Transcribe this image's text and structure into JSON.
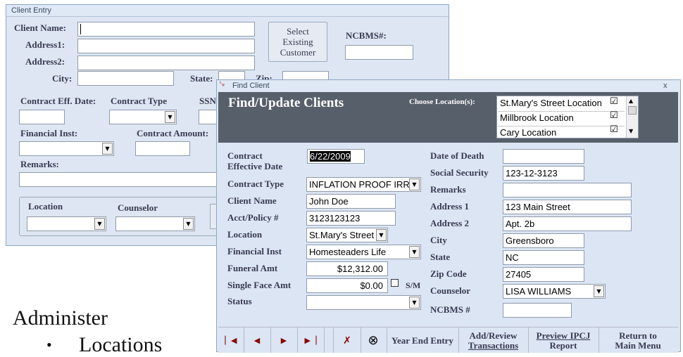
{
  "client_entry": {
    "title": "Client Entry",
    "labels": {
      "client_name": "Client Name:",
      "address1": "Address1:",
      "address2": "Address2:",
      "city": "City:",
      "state": "State:",
      "zip": "Zip:",
      "ncbms": "NCBMS#:",
      "contract_eff_date": "Contract Eff. Date:",
      "contract_type": "Contract Type",
      "ssn": "SSN",
      "financial_inst": "Financial Inst:",
      "contract_amount": "Contract Amount:",
      "remarks": "Remarks:",
      "location": "Location",
      "counselor": "Counselor"
    },
    "select_button": "Select Existing Customer"
  },
  "slide": {
    "heading": "Administer",
    "bullet": "Locations"
  },
  "find_client": {
    "title": "Find Client",
    "close": "x",
    "heading": "Find/Update Clients",
    "choose_location_label": "Choose Location(s):",
    "locations": [
      {
        "name": "St.Mary's Street Location",
        "checked": true
      },
      {
        "name": "Millbrook Location",
        "checked": true
      },
      {
        "name": "Cary Location",
        "checked": true
      }
    ],
    "left": {
      "contract_effective_date_label": "Contract Effective Date",
      "contract_effective_date": "6/22/2009",
      "contract_type_label": "Contract Type",
      "contract_type": "INFLATION PROOF IRRE",
      "client_name_label": "Client Name",
      "client_name": "John Doe",
      "acct_policy_label": "Acct/Policy #",
      "acct_policy": "3123123123",
      "location_label": "Location",
      "location": "St.Mary's Street",
      "financial_inst_label": "Financial Inst",
      "financial_inst": "Homesteaders Life",
      "funeral_amt_label": "Funeral Amt",
      "funeral_amt": "$12,312.00",
      "single_face_amt_label": "Single Face Amt",
      "single_face_amt": "$0.00",
      "sm_label": "S/M",
      "sm_checked": false,
      "status_label": "Status",
      "status": ""
    },
    "right": {
      "date_of_death_label": "Date of Death",
      "date_of_death": "",
      "social_security_label": "Social Security",
      "social_security": "123-12-3123",
      "remarks_label": "Remarks",
      "remarks": "",
      "address1_label": "Address 1",
      "address1": "123 Main Street",
      "address2_label": "Address 2",
      "address2": "Apt. 2b",
      "city_label": "City",
      "city": "Greensboro",
      "state_label": "State",
      "state": "NC",
      "zip_label": "Zip Code",
      "zip": "27405",
      "counselor_label": "Counselor",
      "counselor": "LISA WILLIAMS",
      "ncbms_label": "NCBMS #",
      "ncbms": ""
    },
    "toolbar": {
      "first": "first-record-icon",
      "prev": "previous-record-icon",
      "next": "next-record-icon",
      "last": "last-record-icon",
      "delete": "delete-record-icon",
      "find": "binoculars-icon",
      "year_end": "Year End Entry",
      "add_review_1": "Add/Review",
      "add_review_2": "Transactions",
      "preview_1": "Preview IPCJ",
      "preview_2": "Report",
      "return_1": "Return to",
      "return_2": "Main Menu"
    }
  }
}
